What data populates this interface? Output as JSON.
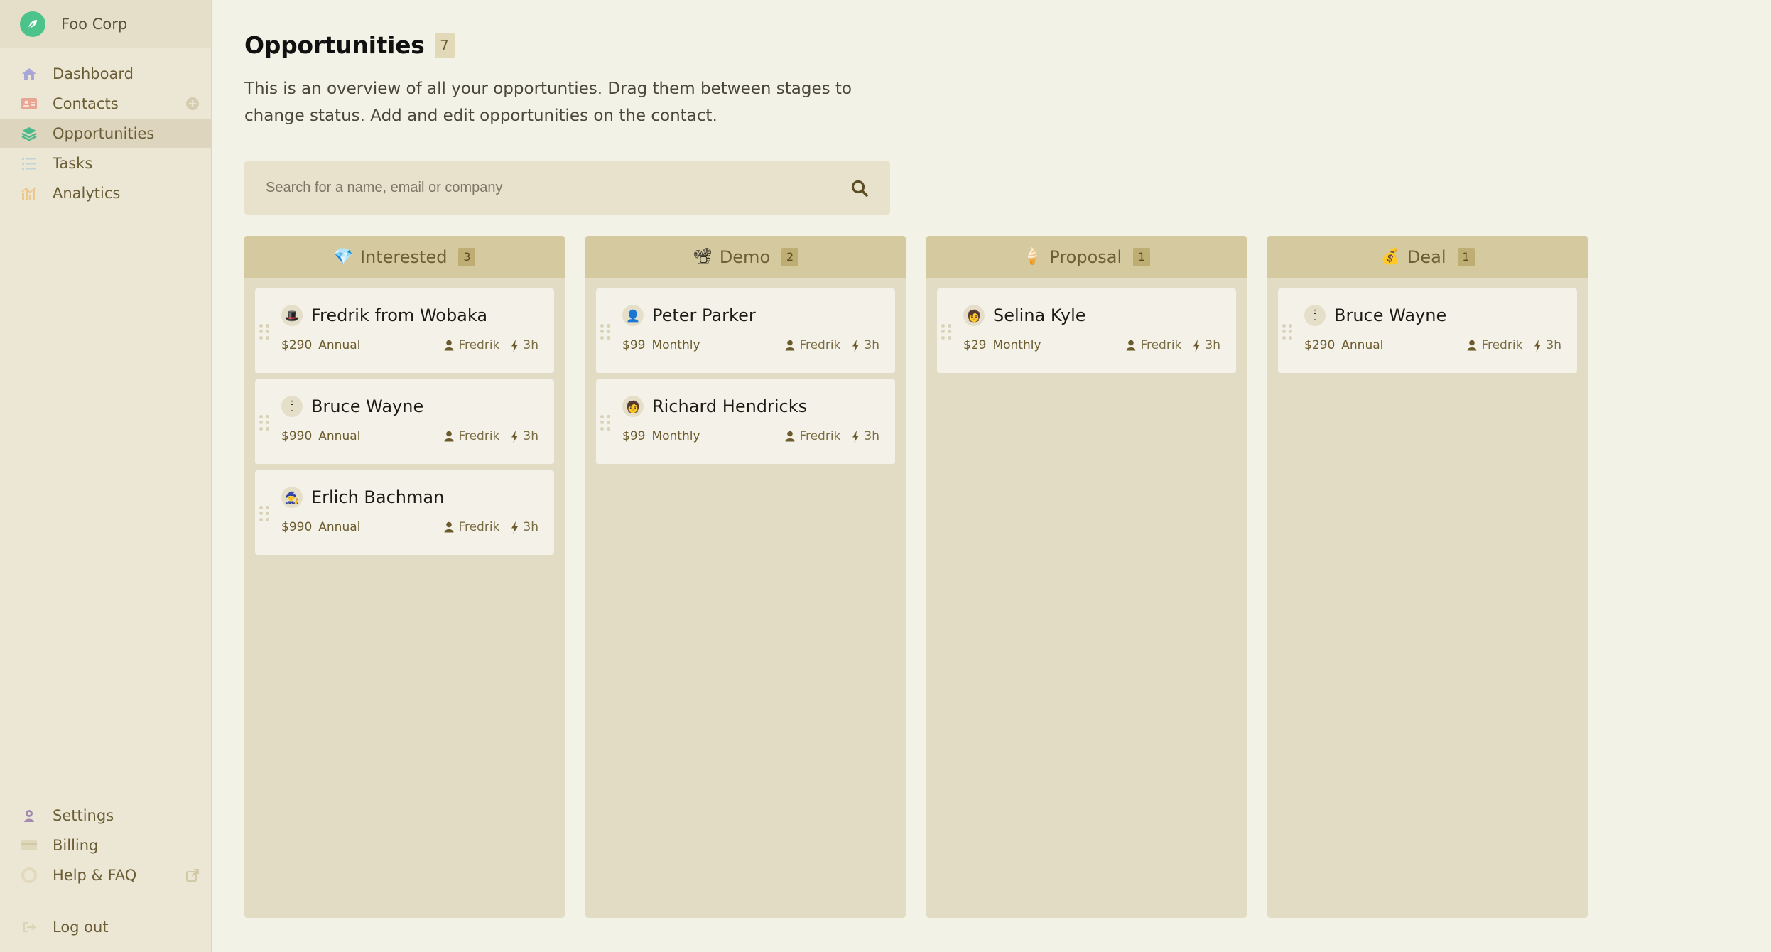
{
  "org": {
    "name": "Foo Corp"
  },
  "nav": {
    "top": [
      {
        "label": "Dashboard",
        "icon": "home-icon"
      },
      {
        "label": "Contacts",
        "icon": "contact-card-icon"
      },
      {
        "label": "Opportunities",
        "icon": "layers-icon",
        "active": true
      },
      {
        "label": "Tasks",
        "icon": "list-icon"
      },
      {
        "label": "Analytics",
        "icon": "chart-icon"
      }
    ],
    "bottom": [
      {
        "label": "Settings",
        "icon": "user-gear-icon"
      },
      {
        "label": "Billing",
        "icon": "credit-card-icon"
      },
      {
        "label": "Help & FAQ",
        "icon": "lifebuoy-icon"
      }
    ],
    "logout": "Log out"
  },
  "page": {
    "title": "Opportunities",
    "count": "7",
    "description": "This is an overview of all your opportunties. Drag them between stages to change status. Add and edit opportunities on the contact."
  },
  "search": {
    "placeholder": "Search for a name, email or company"
  },
  "columns": [
    {
      "emoji": "💎",
      "title": "Interested",
      "count": "3",
      "cards": [
        {
          "name": "Fredrik from Wobaka",
          "amount": "$290",
          "plan": "Annual",
          "owner": "Fredrik",
          "age": "3h",
          "avatar": "🎩"
        },
        {
          "name": "Bruce Wayne",
          "amount": "$990",
          "plan": "Annual",
          "owner": "Fredrik",
          "age": "3h",
          "avatar": "🕯"
        },
        {
          "name": "Erlich Bachman",
          "amount": "$990",
          "plan": "Annual",
          "owner": "Fredrik",
          "age": "3h",
          "avatar": "🧙"
        }
      ]
    },
    {
      "emoji": "📽",
      "title": "Demo",
      "count": "2",
      "cards": [
        {
          "name": "Peter Parker",
          "amount": "$99",
          "plan": "Monthly",
          "owner": "Fredrik",
          "age": "3h",
          "avatar": "👤"
        },
        {
          "name": "Richard Hendricks",
          "amount": "$99",
          "plan": "Monthly",
          "owner": "Fredrik",
          "age": "3h",
          "avatar": "🧑"
        }
      ]
    },
    {
      "emoji": "🍦",
      "title": "Proposal",
      "count": "1",
      "cards": [
        {
          "name": "Selina Kyle",
          "amount": "$29",
          "plan": "Monthly",
          "owner": "Fredrik",
          "age": "3h",
          "avatar": "🧑"
        }
      ]
    },
    {
      "emoji": "💰",
      "title": "Deal",
      "count": "1",
      "cards": [
        {
          "name": "Bruce Wayne",
          "amount": "$290",
          "plan": "Annual",
          "owner": "Fredrik",
          "age": "3h",
          "avatar": "🕯"
        }
      ]
    }
  ],
  "colors": {
    "accent": "#4cc38a",
    "sidebar": "#ece6d4",
    "column": "#e2dcc4",
    "column_header": "#d5c99f",
    "card": "#f4f2e8"
  }
}
